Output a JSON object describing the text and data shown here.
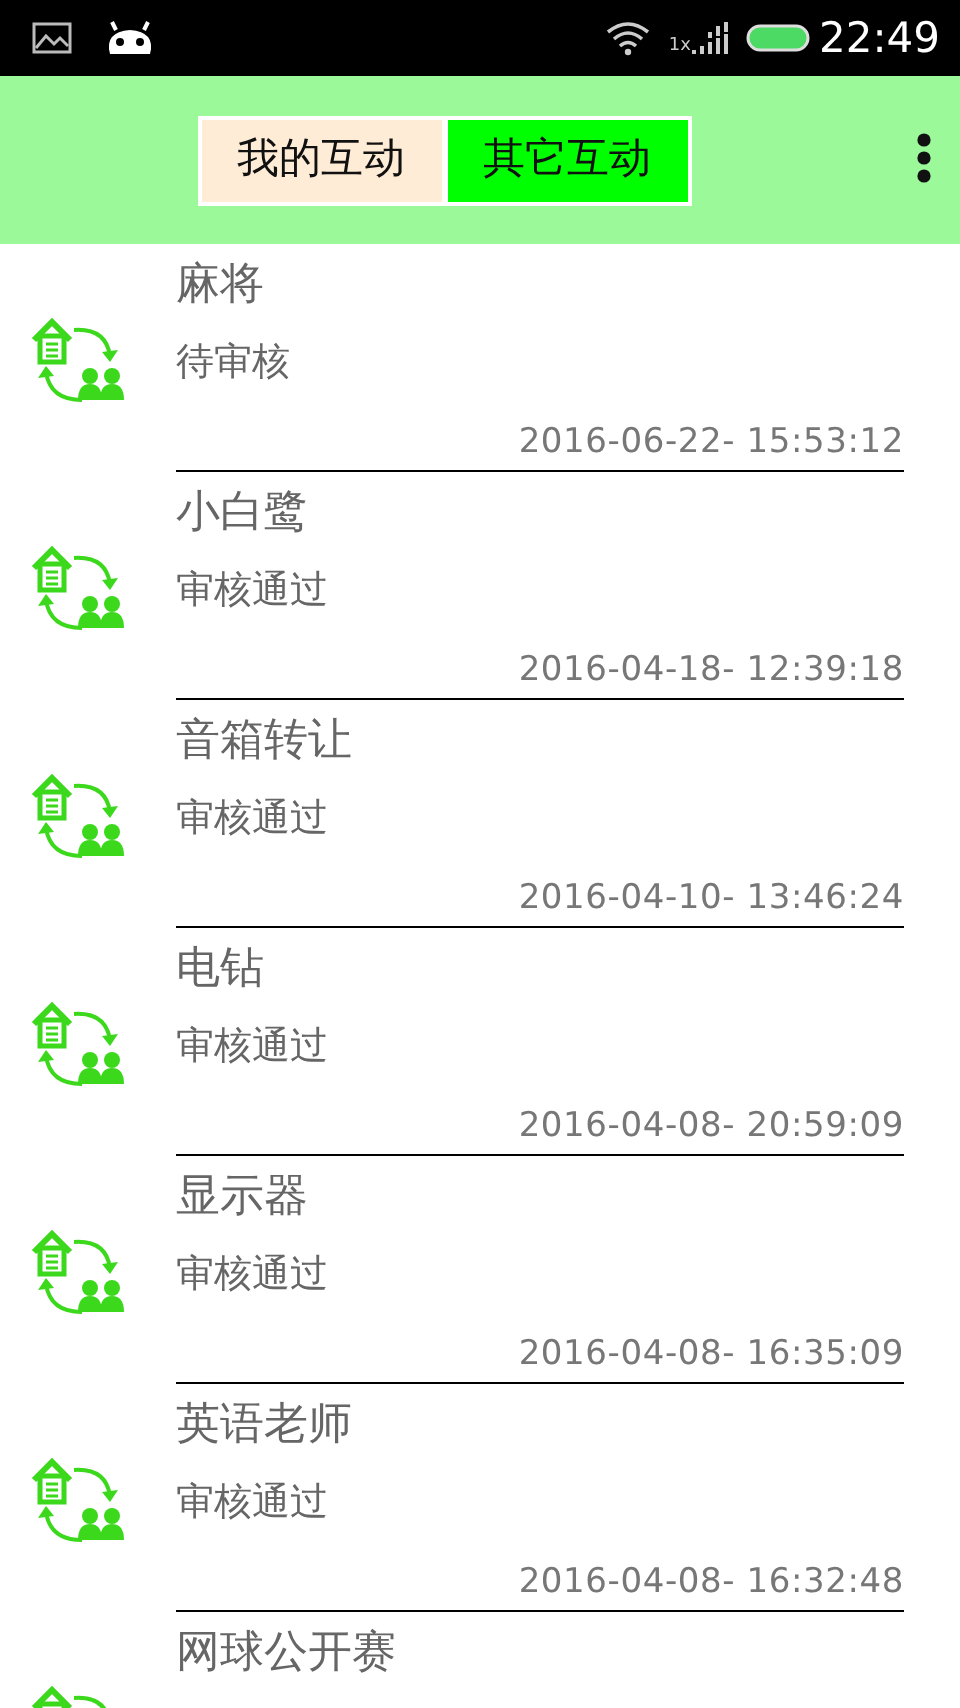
{
  "status_bar": {
    "network_label": "1x",
    "time": "22:49"
  },
  "tabs": [
    {
      "label": "我的互动",
      "selected": false
    },
    {
      "label": "其它互动",
      "selected": true
    }
  ],
  "items": [
    {
      "title": "麻将",
      "status": "待审核",
      "date": "2016-06-22- 15:53:12"
    },
    {
      "title": "小白鹭",
      "status": "审核通过",
      "date": "2016-04-18- 12:39:18"
    },
    {
      "title": "音箱转让",
      "status": "审核通过",
      "date": "2016-04-10- 13:46:24"
    },
    {
      "title": "电钻",
      "status": "审核通过",
      "date": "2016-04-08- 20:59:09"
    },
    {
      "title": "显示器",
      "status": "审核通过",
      "date": "2016-04-08- 16:35:09"
    },
    {
      "title": "英语老师",
      "status": "审核通过",
      "date": "2016-04-08- 16:32:48"
    },
    {
      "title": "网球公开赛"
    }
  ]
}
